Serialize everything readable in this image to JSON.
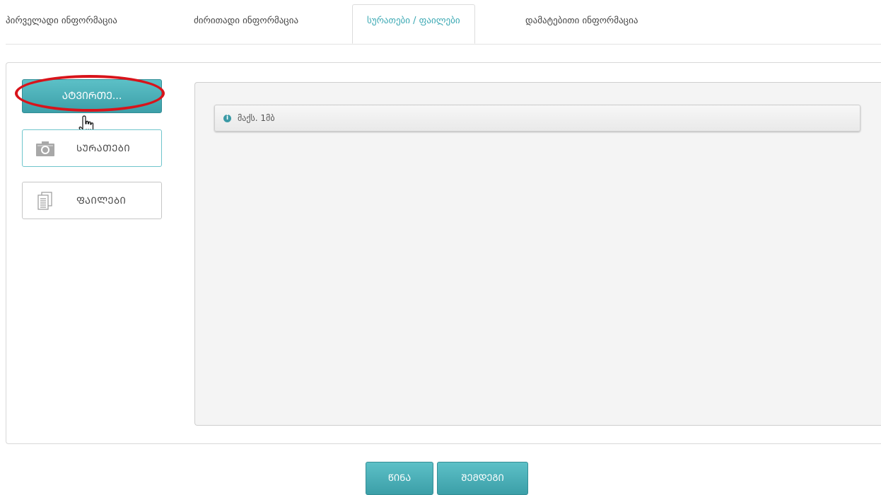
{
  "tabs": [
    {
      "label": "პირველადი ინფორმაცია"
    },
    {
      "label": "ძირითადი ინფორმაცია"
    },
    {
      "label": "სურათები / ფაილები"
    },
    {
      "label": "დამატებითი ინფორმაცია"
    }
  ],
  "active_tab": "სურათები / ფაილები",
  "upload": {
    "browse_label": "ᲐᲢᲕᲘᲠᲗᲔ...",
    "photos_label": "ᲡᲣᲠᲐᲗᲔᲑᲘ",
    "files_label": "ᲤᲐᲘᲚᲔᲑᲘ",
    "photos_icon": "camera-icon",
    "files_icon": "documents-icon",
    "info_text": "მაქს. 1მბ"
  },
  "footer": {
    "prev_label": "ᲬᲘᲜᲐ",
    "next_label": "ᲨᲔᲛᲓᲔᲒᲘ"
  },
  "colors": {
    "accent": "#3aa8b3",
    "button": "#46adb5",
    "highlight_ring": "#d8141b"
  }
}
